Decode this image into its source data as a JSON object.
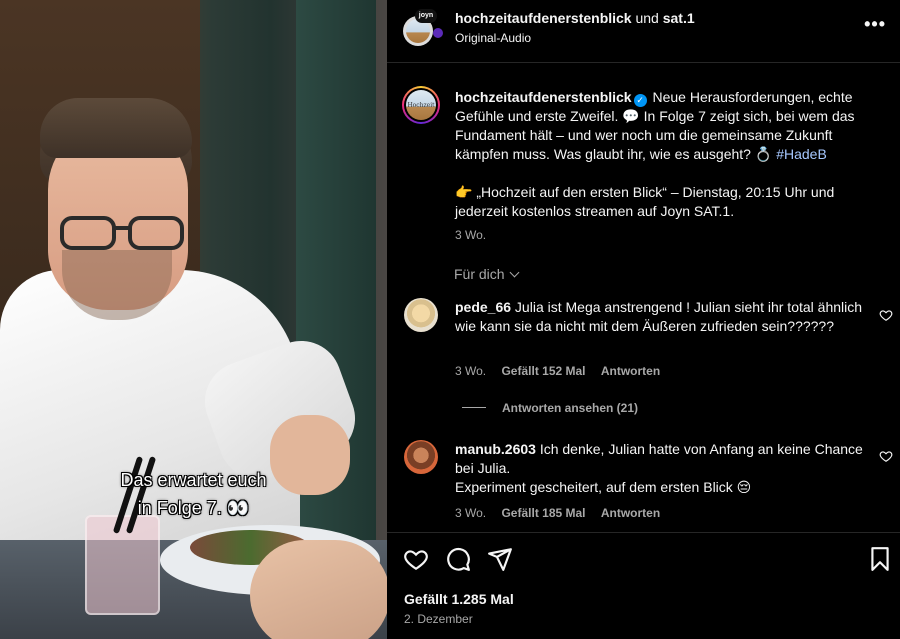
{
  "video": {
    "caption_line1": "Das erwartet euch",
    "caption_line2": "in Folge 7. 👀"
  },
  "header": {
    "username": "hochzeitaufdenerstenblick",
    "joiner": "und",
    "collaborator": "sat.1",
    "audio": "Original-Audio",
    "badge": "joyn",
    "more_icon": "more-horizontal-icon"
  },
  "post": {
    "username": "hochzeitaufdenerstenblick",
    "verified": true,
    "caption_part1": " Neue Herausforderungen, echte Gefühle und erste Zweifel. 💬 In Folge 7 zeigt sich, bei wem das Fundament hält – und wer noch um die gemeinsame Zukunft kämpfen muss. Was glaubt ihr, wie es ausgeht? 💍 ",
    "hashtag": "#HadeB",
    "caption_part2": "👉 „Hochzeit auf den ersten Blick“ – Dienstag, 20:15 Uhr und jederzeit kostenlos streamen auf Joyn SAT.1.",
    "time": "3 Wo.",
    "avatar_label": "Hochzeit"
  },
  "filter": {
    "label": "Für dich"
  },
  "comments": [
    {
      "username": "pede_66",
      "text": " Julia ist Mega anstrengend ! Julian sieht ihr total ähnlich wie kann sie da nicht mit dem Äußeren zufrieden sein??????",
      "time": "3 Wo.",
      "likes": "Gefällt 152 Mal",
      "reply": "Antworten"
    },
    {
      "username": "manub.2603",
      "text": " Ich denke, Julian hatte von Anfang an keine Chance bei Julia.",
      "text2": "Experiment gescheitert, auf dem ersten Blick 😔",
      "time": "3 Wo.",
      "likes": "Gefällt 185 Mal",
      "reply": "Antworten"
    }
  ],
  "view_replies": "Antworten ansehen (21)",
  "footer": {
    "likes": "Gefällt 1.285 Mal",
    "date": "2. Dezember"
  },
  "colors": {
    "background": "#000000",
    "text": "#f5f5f5",
    "secondary": "#a8a8a8",
    "verified": "#0095f6",
    "hashtag": "#a6c8ff"
  }
}
